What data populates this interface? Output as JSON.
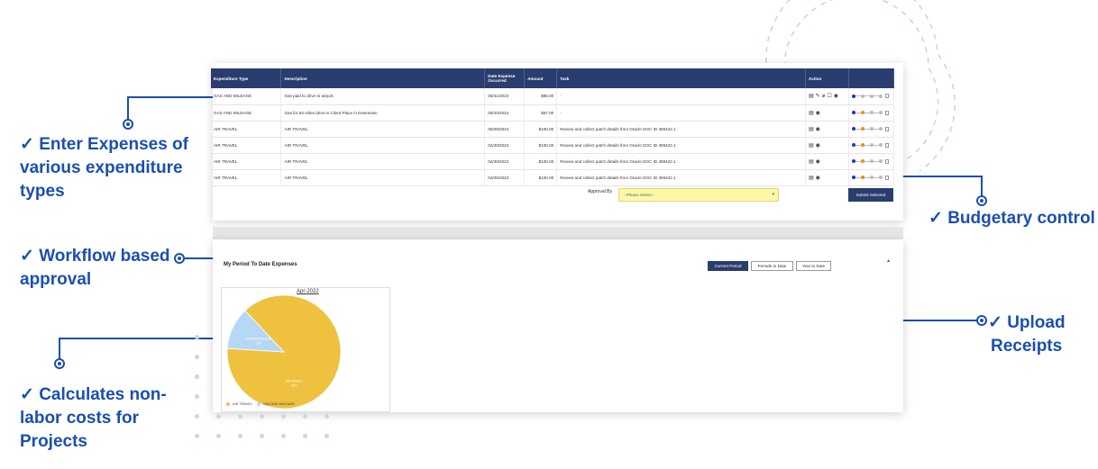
{
  "callouts": {
    "enter_expenses": [
      "✓ Enter Expenses of",
      "various expenditure",
      "types"
    ],
    "workflow": [
      "✓ Workflow based",
      "approval"
    ],
    "calculates": [
      "✓ Calculates non-",
      "labor costs for",
      "Projects"
    ],
    "budgetary": [
      "✓ Budgetary control"
    ],
    "upload": [
      "✓ Upload",
      "Receipts"
    ]
  },
  "table": {
    "headers": [
      "Expenditure Type",
      "Description",
      "Date Expense Occurred",
      "Amount",
      "Task",
      "Action",
      ""
    ],
    "rows": [
      {
        "type": "GAS AND MILEAGE",
        "description": "Gas paid to drive to airport.",
        "date": "05/31/2022",
        "amount": "$88.00",
        "task": "-",
        "actions": [
          "receipt-icon",
          "edit-icon",
          "attach-icon",
          "copy-icon",
          "view-icon"
        ],
        "stage": 1
      },
      {
        "type": "GAS AND MILEAGE",
        "description": "Gas for 53 miles drive to Client Place in Downtown",
        "date": "05/20/2022",
        "amount": "$67.00",
        "task": "-",
        "actions": [
          "receipt-icon",
          "view-icon"
        ],
        "stage": 2
      },
      {
        "type": "AIR TRAVEL",
        "description": "AIR TRAVEL",
        "date": "05/09/2022",
        "amount": "$100.00",
        "task": "Review and collect patch details from Oracle DOC ID 389422.1",
        "actions": [
          "receipt-icon",
          "view-icon"
        ],
        "stage": 2
      },
      {
        "type": "AIR TRAVEL",
        "description": "AIR TRAVEL",
        "date": "04/30/2022",
        "amount": "$100.00",
        "task": "Review and collect patch details from Oracle DOC ID 399422.1",
        "actions": [
          "receipt-icon",
          "view-icon"
        ],
        "stage": 2
      },
      {
        "type": "AIR TRAVEL",
        "description": "AIR TRAVEL",
        "date": "04/30/2022",
        "amount": "$100.00",
        "task": "Review and collect patch details from Oracle DOC ID 399422.1",
        "actions": [
          "receipt-icon",
          "view-icon"
        ],
        "stage": 2
      },
      {
        "type": "AIR TRAVEL",
        "description": "AIR TRAVEL",
        "date": "04/05/2022",
        "amount": "$100.00",
        "task": "Review and collect patch details from Oracle DOC ID 399422.1",
        "actions": [
          "receipt-icon",
          "view-icon"
        ],
        "stage": 2
      }
    ]
  },
  "approval": {
    "label": "Approval By",
    "placeholder": "--Please Select--",
    "submit_label": "Submit Selected"
  },
  "period": {
    "title": "My Period To Date Expenses",
    "tabs": [
      "Current Period",
      "Periods to Date",
      "Year to Date"
    ],
    "active_tab": 0
  },
  "colors": {
    "accent": "#1b4fb0",
    "header": "#2a3d6f",
    "air_travel": "#eec13f",
    "gas_mileage": "#b6d8f6"
  },
  "chart_data": {
    "type": "pie",
    "title": "Apr-2022",
    "slices": [
      {
        "name": "AIR TRAVEL",
        "label": "AIR TRAVEL",
        "sub": "88%",
        "value": 88,
        "color": "#eec13f"
      },
      {
        "name": "GAS AND MILEAGE",
        "label": "GAS AND MILEAGE",
        "sub": "12%",
        "value": 12,
        "color": "#b6d8f6"
      }
    ],
    "legend": [
      "AIR TRAVEL",
      "GAS AND MILEAGE"
    ],
    "legend_position": "bottom-left"
  }
}
